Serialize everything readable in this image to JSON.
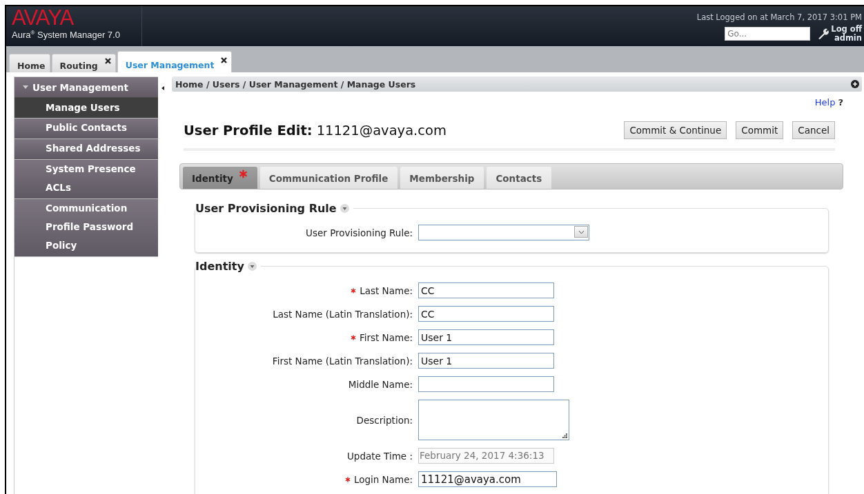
{
  "header": {
    "logo": "AVAYA",
    "product": "Aura$^{®}$ System Manager 7.0",
    "last_logged": "Last Logged on at March 7, 2017 3:01 PM",
    "search": {
      "placeholder": "Go..."
    },
    "logoff": {
      "label": "Log off",
      "user": "admin"
    }
  },
  "tabs": [
    {
      "label": "Home",
      "selected": false,
      "closable": false
    },
    {
      "label": "Routing",
      "selected": false,
      "closable": true
    },
    {
      "label": "User Management",
      "selected": true,
      "closable": true
    }
  ],
  "sidebar": {
    "title": "User Management",
    "expanded": true,
    "items": [
      {
        "label": "Manage Users",
        "selected": true
      },
      {
        "label": "Public Contacts",
        "selected": false
      },
      {
        "label": "Shared Addresses",
        "selected": false
      },
      {
        "label": "System Presence ACLs",
        "selected": false
      },
      {
        "label": "Communication Profile Password Policy",
        "selected": false
      }
    ]
  },
  "breadcrumb": "Home / Users / User Management / Manage Users",
  "help": {
    "label": "Help",
    "mark": "?"
  },
  "page_title": {
    "label": "User Profile Edit:",
    "value": "11121@avaya.com"
  },
  "buttons": [
    "Commit & Continue",
    "Commit",
    "Cancel"
  ],
  "profile_tabs": [
    {
      "label": "Identity",
      "selected": true,
      "required": true
    },
    {
      "label": "Communication Profile",
      "selected": false,
      "required": false
    },
    {
      "label": "Membership",
      "selected": false,
      "required": false
    },
    {
      "label": "Contacts",
      "selected": false,
      "required": false
    }
  ],
  "sections": [
    {
      "title": "User Provisioning Rule",
      "fields": [
        {
          "kind": "select",
          "label": "User Provisioning Rule:",
          "required": false
        }
      ]
    },
    {
      "title": "Identity",
      "fields": [
        {
          "kind": "text",
          "label": "Last Name:",
          "required": true,
          "value": "CC"
        },
        {
          "kind": "text",
          "label": "Last Name (Latin Translation):",
          "required": false,
          "value": "CC"
        },
        {
          "kind": "text",
          "label": "First Name:",
          "required": true,
          "value": "User 1"
        },
        {
          "kind": "text",
          "label": "First Name (Latin Translation):",
          "required": false,
          "value": "User 1"
        },
        {
          "kind": "text",
          "label": "Middle Name:",
          "required": false
        },
        {
          "kind": "textarea",
          "label": "Description:",
          "required": false
        },
        {
          "kind": "readonly",
          "label": "Update Time :",
          "required": false,
          "value": "February 24, 2017 4:36:13"
        },
        {
          "kind": "login",
          "label": "Login Name:",
          "required": true,
          "value": "11121@avaya.com"
        }
      ]
    }
  ]
}
